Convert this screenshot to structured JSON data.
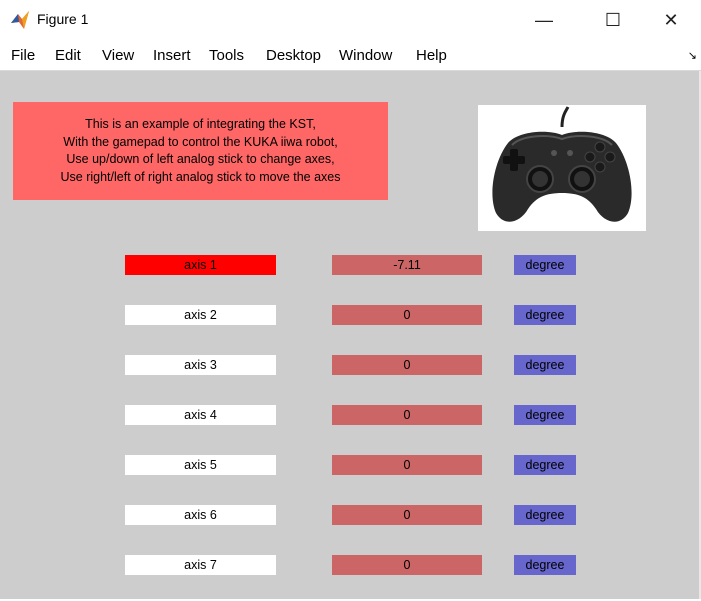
{
  "window": {
    "title": "Figure 1",
    "controls": {
      "minimize": "—",
      "maximize": "☐",
      "close": "✕"
    }
  },
  "menu": {
    "items": [
      "File",
      "Edit",
      "View",
      "Insert",
      "Tools",
      "Desktop",
      "Window",
      "Help"
    ],
    "dock_icon": "↘"
  },
  "info": {
    "lines": [
      "This is an example of integrating the KST,",
      "With the gamepad to control the KUKA iiwa robot,",
      "Use up/down of left analog stick to change axes,",
      "Use right/left of right analog stick to move the axes"
    ]
  },
  "gamepad_image": {
    "icon": "gamepad-icon"
  },
  "axes": [
    {
      "label": "axis  1",
      "value": "-7.11",
      "unit": "degree",
      "active": true
    },
    {
      "label": "axis  2",
      "value": "0",
      "unit": "degree",
      "active": false
    },
    {
      "label": "axis  3",
      "value": "0",
      "unit": "degree",
      "active": false
    },
    {
      "label": "axis  4",
      "value": "0",
      "unit": "degree",
      "active": false
    },
    {
      "label": "axis  5",
      "value": "0",
      "unit": "degree",
      "active": false
    },
    {
      "label": "axis  6",
      "value": "0",
      "unit": "degree",
      "active": false
    },
    {
      "label": "axis  7",
      "value": "0",
      "unit": "degree",
      "active": false
    }
  ],
  "colors": {
    "canvas": "#cdcdcd",
    "info_box": "#ff6666",
    "active_axis": "#ff0000",
    "value_box": "#cc6666",
    "unit_box": "#6666cc"
  }
}
